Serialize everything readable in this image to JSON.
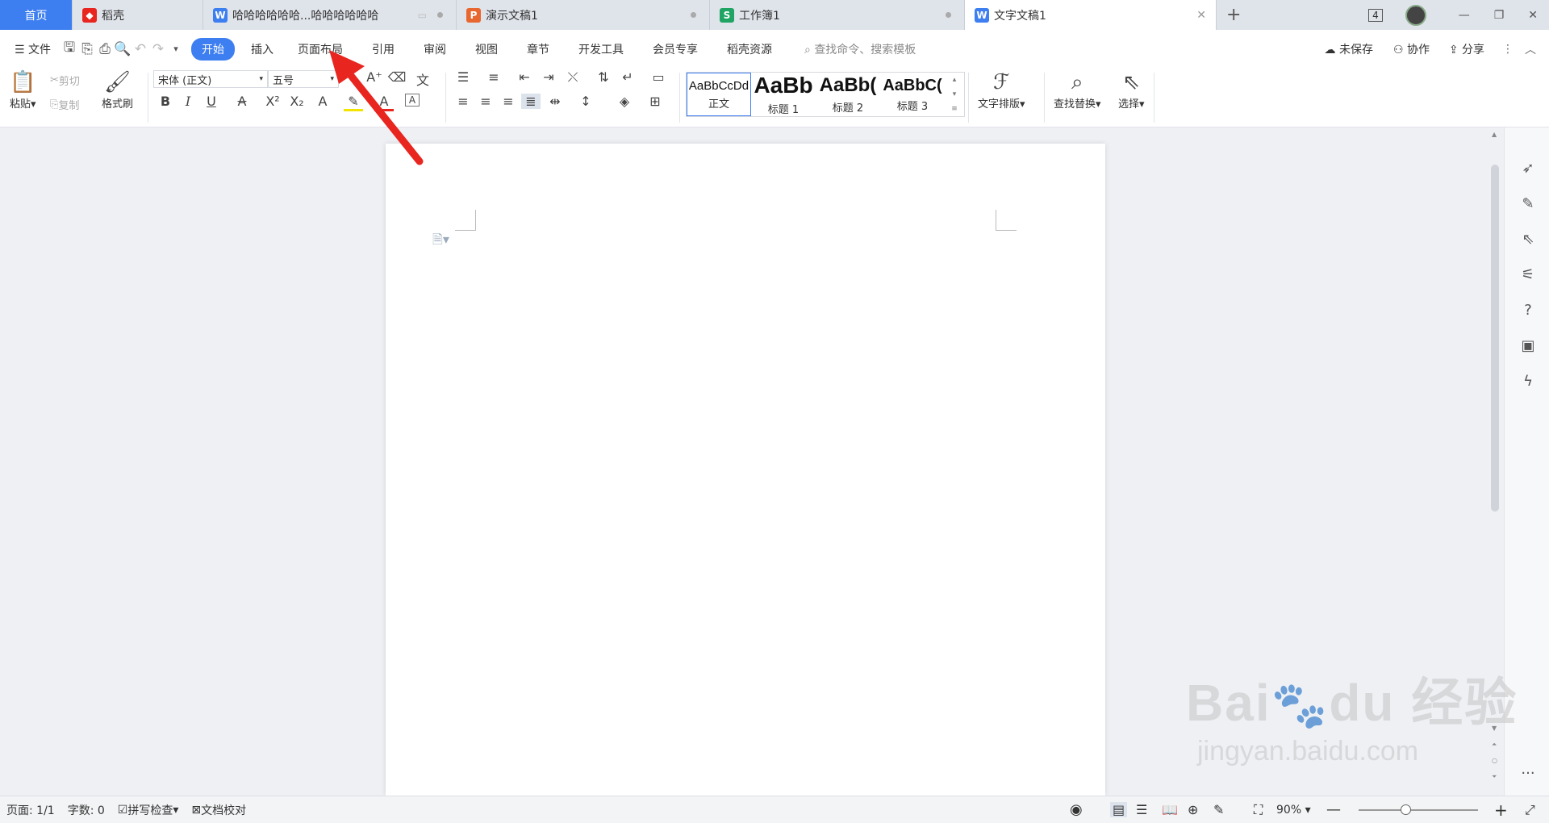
{
  "tabs": [
    {
      "label": "首页"
    },
    {
      "label": "稻壳"
    },
    {
      "label": "哈哈哈哈哈哈...哈哈哈哈哈哈"
    },
    {
      "label": "演示文稿1"
    },
    {
      "label": "工作簿1"
    },
    {
      "label": "文字文稿1"
    }
  ],
  "tab_counter": "4",
  "menu": {
    "file": "文件",
    "items": [
      "开始",
      "插入",
      "页面布局",
      "引用",
      "审阅",
      "视图",
      "章节",
      "开发工具",
      "会员专享",
      "稻壳资源"
    ],
    "search_placeholder": "查找命令、搜索模板",
    "unsaved": "未保存",
    "collab": "协作",
    "share": "分享"
  },
  "ribbon": {
    "paste": "粘贴",
    "cut": "剪切",
    "copy": "复制",
    "format_painter": "格式刷",
    "font_name": "宋体 (正文)",
    "font_size": "五号",
    "styles": [
      {
        "sample": "AaBbCcDd",
        "caption": "正文"
      },
      {
        "sample": "AaBb",
        "caption": "标题 1"
      },
      {
        "sample": "AaBb(",
        "caption": "标题 2"
      },
      {
        "sample": "AaBbC(",
        "caption": "标题 3"
      }
    ],
    "text_layout": "文字排版",
    "find_replace": "查找替换",
    "select": "选择"
  },
  "status": {
    "page": "页面: 1/1",
    "words": "字数: 0",
    "spellcheck": "拼写检查",
    "proofread": "文档校对",
    "zoom": "90%"
  },
  "watermark": {
    "logo": "Bai du 经验",
    "url": "jingyan.baidu.com"
  },
  "colors": {
    "accent": "#3d7ef0",
    "annotation_arrow": "#e8251f"
  }
}
